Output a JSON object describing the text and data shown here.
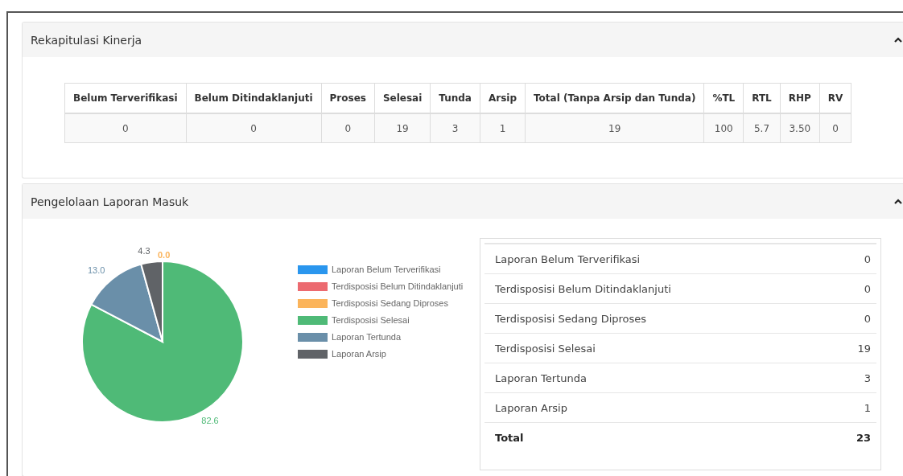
{
  "panels": [
    {
      "title": "Rekapitulasi Kinerja",
      "expanded": true
    },
    {
      "title": "Pengelolaan Laporan Masuk",
      "expanded": true
    }
  ],
  "summary_table": {
    "columns": [
      "Belum Terverifikasi",
      "Belum Ditindaklanjuti",
      "Proses",
      "Selesai",
      "Tunda",
      "Arsip",
      "Total (Tanpa Arsip dan Tunda)",
      "%TL",
      "RTL",
      "RHP",
      "RV"
    ],
    "rows": [
      [
        "0",
        "0",
        "0",
        "19",
        "3",
        "1",
        "19",
        "100",
        "5.7",
        "3.50",
        "0"
      ]
    ]
  },
  "chart_data": {
    "type": "pie",
    "categories": [
      "Laporan Belum Terverifikasi",
      "Terdisposisi Belum Ditindaklanjuti",
      "Terdisposisi Sedang Diproses",
      "Terdisposisi Selesai",
      "Laporan Tertunda",
      "Laporan Arsip"
    ],
    "values": [
      0,
      0,
      0,
      82.6,
      13.0,
      4.3
    ],
    "legend": "right",
    "value_labels": [
      null,
      null,
      "0.0",
      "82.6",
      "13.0",
      "4.3"
    ],
    "colors": [
      "#2a96ee",
      "#ec6a70",
      "#fbb45b",
      "#4fba77",
      "#6a8fa9",
      "#606367"
    ]
  },
  "report_list": [
    {
      "label": "Laporan Belum Terverifikasi",
      "value": "0",
      "kind": "item"
    },
    {
      "label": "Terdisposisi Belum Ditindaklanjuti",
      "value": "0",
      "kind": "item"
    },
    {
      "label": "Terdisposisi Sedang Diproses",
      "value": "0",
      "kind": "item"
    },
    {
      "label": "Terdisposisi Selesai",
      "value": "19",
      "kind": "item"
    },
    {
      "label": "Laporan Tertunda",
      "value": "3",
      "kind": "item"
    },
    {
      "label": "Laporan Arsip",
      "value": "1",
      "kind": "item"
    },
    {
      "label": "Total",
      "value": "23",
      "kind": "total"
    }
  ]
}
